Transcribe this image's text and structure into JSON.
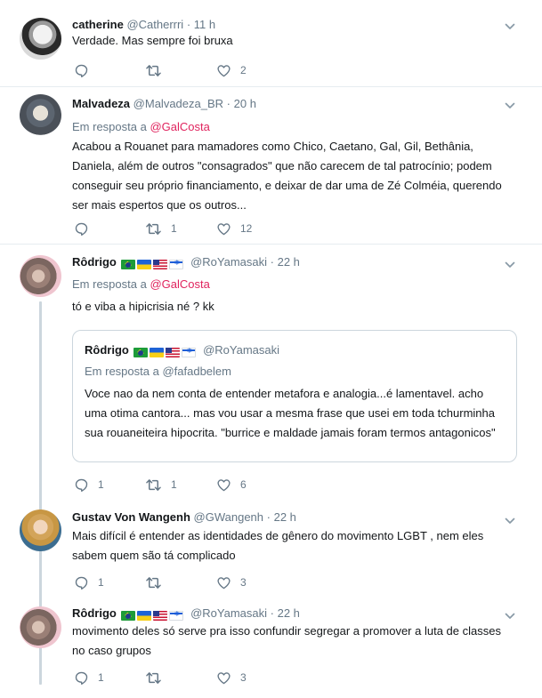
{
  "tweets": [
    {
      "name": "catherine",
      "handle": "@Catherrri",
      "separator": "·",
      "time": "11 h",
      "text": "Verdade. Mas sempre foi bruxa",
      "replies": "",
      "retweets": "",
      "likes": "2"
    },
    {
      "name": "Malvadeza",
      "handle": "@Malvadeza_BR",
      "separator": "·",
      "time": "20 h",
      "reply_prefix": "Em resposta a",
      "reply_mention": "@GalCosta",
      "text": "Acabou a Rouanet para mamadores como Chico, Caetano, Gal, Gil, Bethânia, Daniela, além de outros \"consagrados\" que não carecem de tal patrocínio; podem conseguir seu próprio financiamento, e deixar de dar uma de Zé Colméia, querendo ser mais espertos que os outros...",
      "replies": "",
      "retweets": "1",
      "likes": "12"
    },
    {
      "name": "Rôdrigo",
      "handle": "@RoYamasaki",
      "separator": "·",
      "time": "22 h",
      "reply_prefix": "Em resposta a",
      "reply_mention": "@GalCosta",
      "text": "tó e viba a hipicrisia né ? kk",
      "quote": {
        "name": "Rôdrigo",
        "handle": "@RoYamasaki",
        "reply_prefix": "Em resposta a",
        "reply_mention": "@fafadbelem",
        "text": "Voce nao da nem conta de entender metafora e analogia...é lamentavel. acho uma otima cantora... mas vou usar a mesma frase que usei em toda tchurminha sua rouaneiteira hipocrita. \"burrice e maldade jamais foram termos antagonicos\""
      },
      "replies": "1",
      "retweets": "1",
      "likes": "6"
    },
    {
      "name": "Gustav Von Wangenh",
      "handle": "@GWangenh",
      "separator": "·",
      "time": "22 h",
      "text": "Mais difícil é entender as identidades de gênero do movimento LGBT , nem eles sabem quem são tá complicado",
      "replies": "1",
      "retweets": "",
      "likes": "3"
    },
    {
      "name": "Rôdrigo",
      "handle": "@RoYamasaki",
      "separator": "·",
      "time": "22 h",
      "text": "movimento deles só serve pra isso confundir segregar a promover a luta de classes no caso grupos",
      "replies": "1",
      "retweets": "",
      "likes": "3"
    }
  ],
  "icons": {
    "reply": "reply-icon",
    "retweet": "retweet-icon",
    "like": "heart-icon",
    "menu": "chevron-down-icon"
  },
  "colors": {
    "mention": "#e0245e",
    "secondary_text": "#657786",
    "thread_line": "#ccd6dd",
    "divider": "#e6ecf0"
  }
}
